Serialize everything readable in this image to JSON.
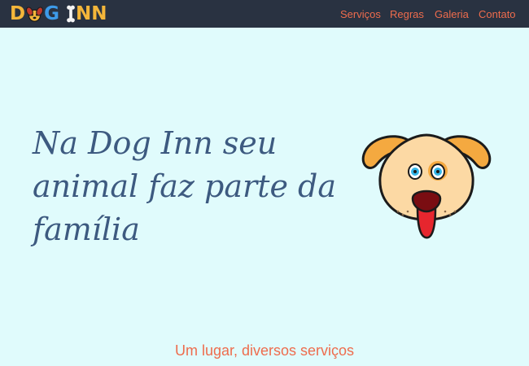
{
  "brand": {
    "logo_text": "DOG INN",
    "logo_first": "D",
    "logo_second": "G",
    "logo_third": "I",
    "logo_fourth": "NN"
  },
  "nav": {
    "items": [
      {
        "label": "Serviços"
      },
      {
        "label": "Regras"
      },
      {
        "label": "Galeria"
      },
      {
        "label": "Contato"
      }
    ]
  },
  "hero": {
    "title": "Na Dog Inn seu animal faz parte da família"
  },
  "section": {
    "heading": "Um lugar, diversos serviços"
  },
  "colors": {
    "navbar_bg": "#293241",
    "page_bg": "#e0fbfc",
    "accent": "#ee6c4d",
    "title": "#3d5a80",
    "logo_yellow": "#f4b63a",
    "logo_blue": "#3d9be9"
  },
  "icons": {
    "logo_paw": "paw-icon",
    "logo_bone": "bone-icon",
    "hero_image": "dog-face-illustration"
  }
}
